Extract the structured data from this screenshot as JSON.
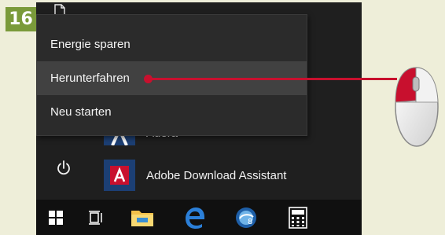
{
  "step": {
    "number": "16"
  },
  "power_menu": {
    "items": [
      {
        "label": "Energie sparen",
        "highlighted": false
      },
      {
        "label": "Herunterfahren",
        "highlighted": true
      },
      {
        "label": "Neu starten",
        "highlighted": false
      }
    ]
  },
  "apps": [
    {
      "label": "Adera",
      "icon": "adera-app-icon"
    },
    {
      "label": "Adobe Download Assistant",
      "icon": "adobe-download-assistant-icon"
    }
  ],
  "taskbar": {
    "items": [
      "windows-start-icon",
      "task-view-icon",
      "file-explorer-icon",
      "edge-icon",
      "app-3-icon",
      "calculator-icon"
    ]
  },
  "colors": {
    "accent_red": "#c8102e",
    "badge_green": "#7a9a3a",
    "page_bg": "#eeeed9",
    "menu_bg": "#2b2b2b",
    "menu_highlight": "#414141"
  }
}
